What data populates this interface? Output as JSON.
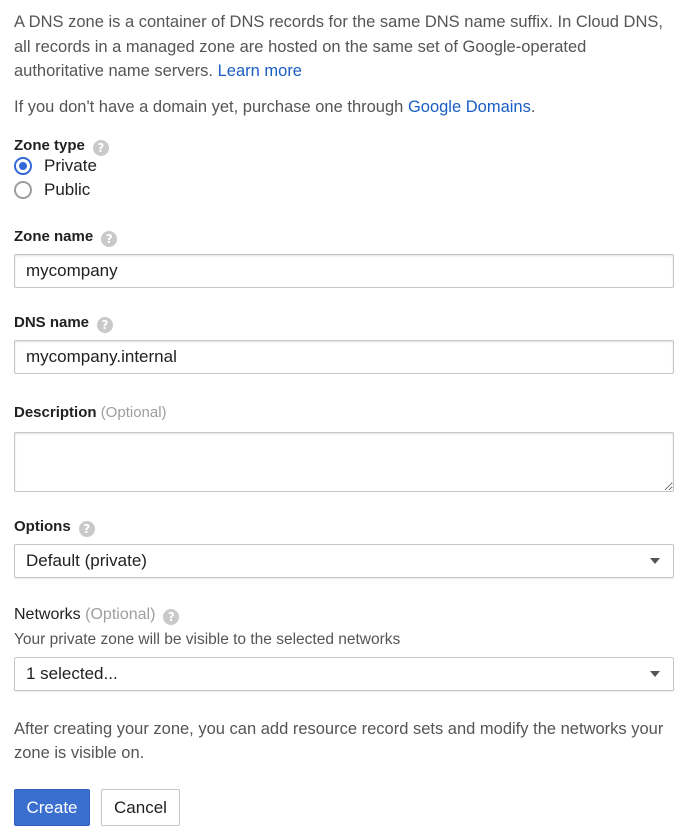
{
  "intro": {
    "text": "A DNS zone is a container of DNS records for the same DNS name suffix. In Cloud DNS, all records in a managed zone are hosted on the same set of Google-operated authoritative name servers.",
    "learn_more": "Learn more",
    "domain_text": "If you don't have a domain yet, purchase one through",
    "domains_link": "Google Domains",
    "domain_end": "."
  },
  "zone_type": {
    "label": "Zone type",
    "options": [
      {
        "label": "Private",
        "checked": true
      },
      {
        "label": "Public",
        "checked": false
      }
    ]
  },
  "zone_name": {
    "label": "Zone name",
    "value": "mycompany"
  },
  "dns_name": {
    "label": "DNS name",
    "value": "mycompany.internal"
  },
  "description": {
    "label": "Description",
    "optional": "(Optional)",
    "value": ""
  },
  "options": {
    "label": "Options",
    "value": "Default (private)"
  },
  "networks": {
    "label": "Networks",
    "optional": "(Optional)",
    "hint": "Your private zone will be visible to the selected networks",
    "value": "1 selected..."
  },
  "after_note": "After creating your zone, you can add resource record sets and modify the networks your zone is visible on.",
  "buttons": {
    "create": "Create",
    "cancel": "Cancel"
  },
  "colors": {
    "accent": "#3367d6",
    "link": "#1a5dc4",
    "primary_button": "#3a6fd0"
  },
  "icons": {
    "help": "help-icon",
    "dropdown": "chevron-down-icon"
  }
}
